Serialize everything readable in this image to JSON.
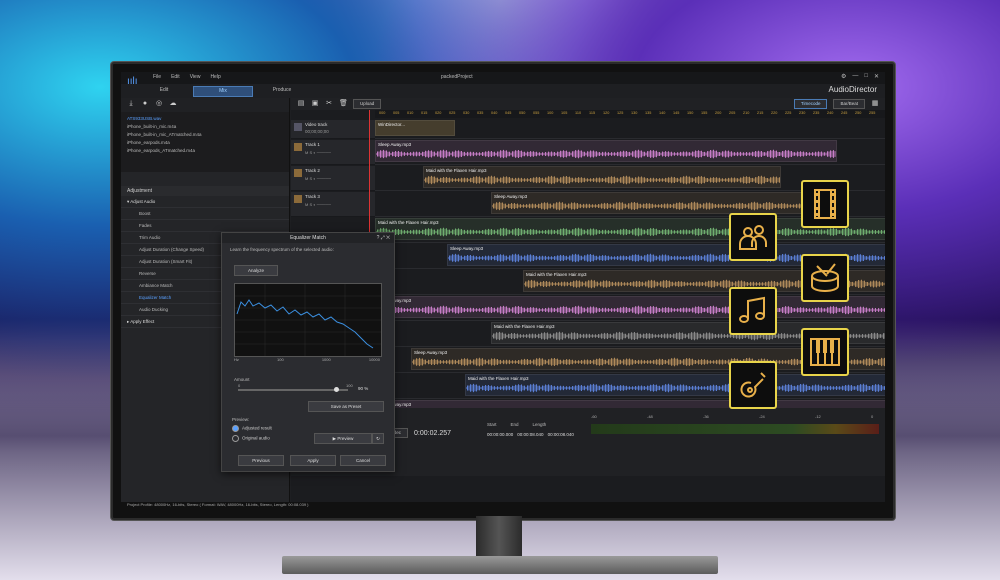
{
  "app": {
    "menu": [
      "File",
      "Edit",
      "View",
      "Help"
    ],
    "project_title": "packedProject",
    "brand": "AudioDirector",
    "modes": [
      "Edit",
      "Mix",
      "Produce"
    ],
    "active_mode": "Mix"
  },
  "library": {
    "files": [
      "ATS933USB.wav",
      "iPhone_built-in_mic.m4a",
      "iPhone_built-in_mic_ATmatched.m4a",
      "iPhone_earpods.m4a",
      "iPhone_earpods_ATmatched.m4a"
    ]
  },
  "adjustment": {
    "header": "Adjustment",
    "group_adjust": "Adjust Audio",
    "items": [
      "Boost",
      "Fades",
      "Trim Audio",
      "Adjust Duration (Change Speed)",
      "Adjust Duration (Smart Fit)",
      "Reverse",
      "Ambiance Match",
      "Equalizer Match",
      "Audio Ducking"
    ],
    "active_item": "Equalizer Match",
    "group_apply": "Apply Effect"
  },
  "toolbar": {
    "upload": "Upload",
    "timecode": "Timecode",
    "barbeat": "Bar/Beat"
  },
  "ruler": [
    "000",
    "005",
    "010",
    "015",
    "020",
    "025",
    "030",
    "035",
    "040",
    "045",
    "050",
    "055",
    "100",
    "105",
    "110",
    "115",
    "120",
    "125",
    "130",
    "135",
    "140",
    "145",
    "150",
    "155",
    "200",
    "205",
    "210",
    "215",
    "220",
    "225",
    "230",
    "235",
    "240",
    "245",
    "250",
    "255"
  ],
  "tracks": {
    "video": {
      "name": "Video track",
      "time": "00;00;00;00",
      "clip": "WinDirector..."
    },
    "audio": [
      {
        "name": "Track 1",
        "clip": "Sleep Away.mp3"
      },
      {
        "name": "Track 2",
        "clip": "Maid with the Flaxen Hair.mp3"
      },
      {
        "name": "Track 3",
        "clip": "Sleep Away.mp3"
      }
    ],
    "lanes": [
      "Maid with the Flaxen Hair.mp3",
      "Sleep Away.mp3",
      "Maid with the Flaxen Hair.mp3",
      "Sleep Away.mp3",
      "Maid with the Flaxen Hair.mp3",
      "Sleep Away.mp3",
      "Maid with the Flaxen Hair.mp3",
      "Sleep Away.mp3"
    ]
  },
  "dialog": {
    "title": "Equalizer Match",
    "desc": "Learn the frequency spectrum of the selected audio:",
    "analyze": "Analyze",
    "graph_x": [
      "Hz",
      "100",
      "1000",
      "10000"
    ],
    "graph_y": [
      "+24",
      "48",
      "40",
      "36",
      "32",
      "24",
      "20",
      "16",
      "12",
      "8",
      "4",
      "100"
    ],
    "amount_label": "Amount",
    "amount_min": "0",
    "amount_max": "100",
    "amount_value": "90",
    "amount_unit": "%",
    "save_preset": "Save as Preset",
    "preview_label": "Preview:",
    "opt_adjusted": "Adjusted result",
    "opt_original": "Original audio",
    "preview_btn": "Preview",
    "previous": "Previous",
    "apply": "Apply",
    "cancel": "Cancel"
  },
  "transport": {
    "zoom": "1.0x",
    "codec": "Codec",
    "time": "0:00:02.257",
    "start_label": "Start",
    "end_label": "End",
    "length_label": "Length",
    "start": "00:00:00.000",
    "end": "00:00:08.040",
    "length": "00:00:08.040",
    "meter_scale": [
      "-60",
      "-48",
      "-36",
      "-24",
      "-12",
      "0"
    ]
  },
  "status": "Project Profile: 48000Hz, 16-bits, Stereo ( Format: WAV, 48000Hz, 16-bits, Stereo, Length: 00:08.039 )",
  "colors": {
    "accent": "#5aa0ff",
    "badge_border": "#e8d44a"
  },
  "badges": [
    "audience-icon",
    "film-strip-icon",
    "music-note-icon",
    "drum-icon",
    "piano-keys-icon",
    "guitar-icon"
  ]
}
